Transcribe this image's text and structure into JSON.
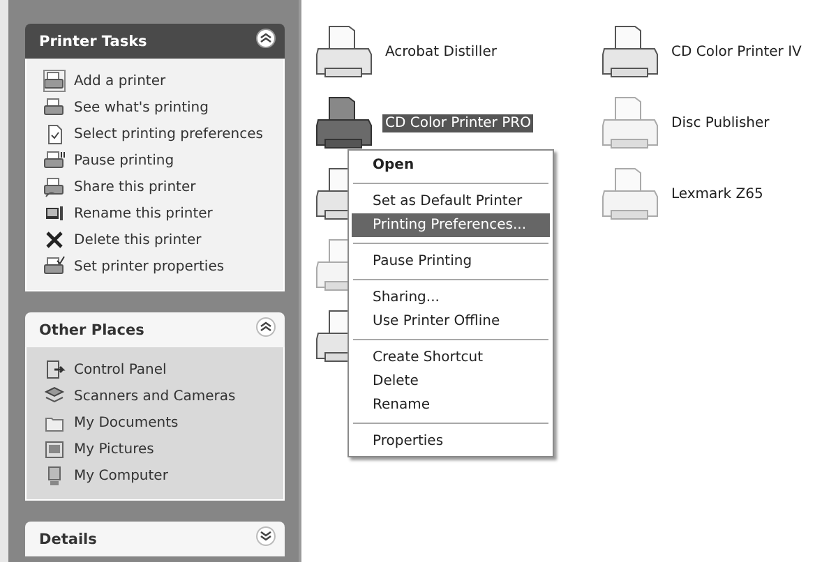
{
  "task_panels": [
    {
      "title": "Printer Tasks",
      "kind": "dark",
      "expanded": true,
      "items": [
        {
          "label": "Add a printer",
          "kind": "add"
        },
        {
          "label": "See what's printing",
          "kind": "queue"
        },
        {
          "label": "Select printing preferences",
          "kind": "prefs"
        },
        {
          "label": "Pause printing",
          "kind": "pause"
        },
        {
          "label": "Share this printer",
          "kind": "share"
        },
        {
          "label": "Rename this printer",
          "kind": "rename"
        },
        {
          "label": "Delete this printer",
          "kind": "delete"
        },
        {
          "label": "Set printer properties",
          "kind": "props"
        }
      ]
    },
    {
      "title": "Other Places",
      "kind": "light",
      "expanded": true,
      "items": [
        {
          "label": "Control Panel",
          "kind": "control"
        },
        {
          "label": "Scanners and Cameras",
          "kind": "scanner"
        },
        {
          "label": "My Documents",
          "kind": "folder"
        },
        {
          "label": "My Pictures",
          "kind": "pictures"
        },
        {
          "label": "My Computer",
          "kind": "computer"
        }
      ]
    },
    {
      "title": "Details",
      "kind": "light",
      "expanded": false
    }
  ],
  "printers": [
    {
      "name": "Acrobat Distiller",
      "selected": false,
      "offline": false
    },
    {
      "name": "CD Color Printer PRO",
      "selected": true,
      "offline": false
    },
    {
      "selected": false,
      "offline": false
    },
    {
      "selected": false,
      "offline": true
    },
    {
      "selected": false,
      "offline": false
    },
    {
      "name": "CD Color Printer IV",
      "selected": false,
      "offline": false
    },
    {
      "name": "Disc Publisher",
      "selected": false,
      "offline": true
    },
    {
      "name": "Lexmark Z65",
      "selected": false,
      "offline": true
    }
  ],
  "context_menu": {
    "groups": [
      [
        {
          "label": "Open",
          "default": true,
          "selected": false
        }
      ],
      [
        {
          "label": "Set as Default Printer",
          "default": false,
          "selected": false
        },
        {
          "label": "Printing Preferences...",
          "default": false,
          "selected": true
        }
      ],
      [
        {
          "label": "Pause Printing",
          "default": false,
          "selected": false
        }
      ],
      [
        {
          "label": "Sharing...",
          "default": false,
          "selected": false
        },
        {
          "label": "Use Printer Offline",
          "default": false,
          "selected": false
        }
      ],
      [
        {
          "label": "Create Shortcut",
          "default": false,
          "selected": false
        },
        {
          "label": "Delete",
          "default": false,
          "selected": false
        },
        {
          "label": "Rename",
          "default": false,
          "selected": false
        }
      ],
      [
        {
          "label": "Properties",
          "default": false,
          "selected": false
        }
      ]
    ]
  }
}
